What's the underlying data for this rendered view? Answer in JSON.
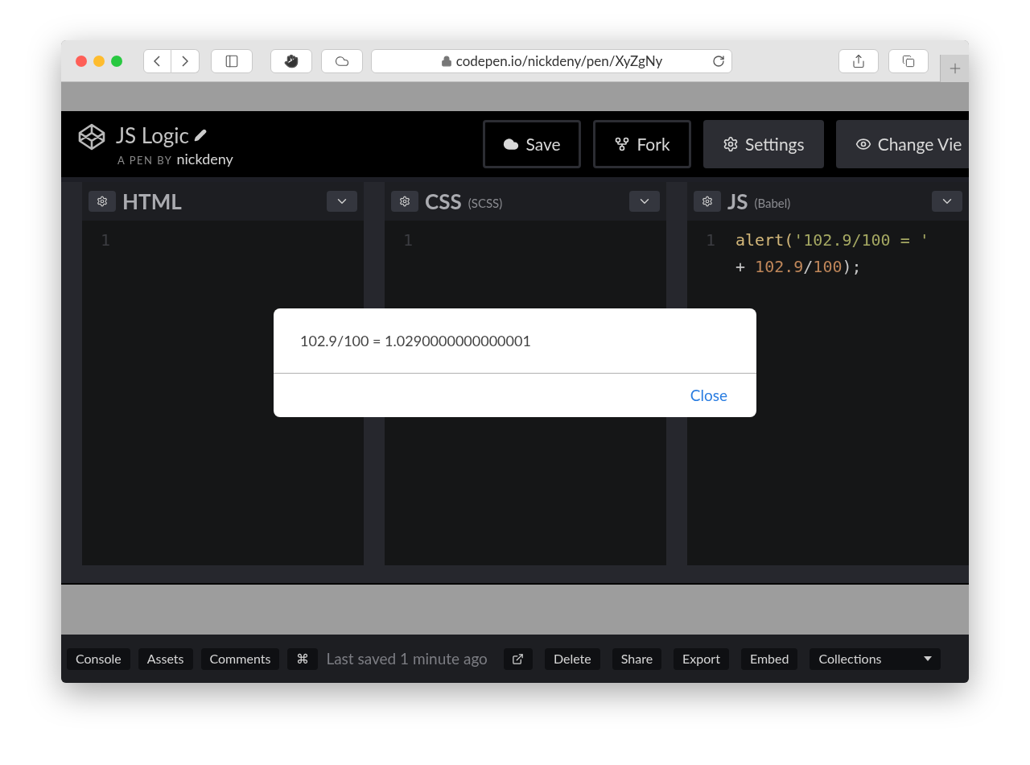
{
  "browser": {
    "url": "codepen.io/nickdeny/pen/XyZgNy"
  },
  "pen": {
    "title": "JS Logic",
    "byline_prefix": "A PEN BY",
    "author": "nickdeny"
  },
  "header_buttons": [
    {
      "label": "Save",
      "kind": "outline"
    },
    {
      "label": "Fork",
      "kind": "outline"
    },
    {
      "label": "Settings",
      "kind": "filled"
    },
    {
      "label": "Change Vie",
      "kind": "filled"
    }
  ],
  "editors": [
    {
      "name": "HTML",
      "lines": [
        {
          "number": "1"
        }
      ]
    },
    {
      "name": "CSS",
      "preprocessor": "(SCSS)",
      "lines": [
        {
          "number": "1"
        }
      ]
    },
    {
      "name": "JS",
      "preprocessor": "(Babel)",
      "lines": [
        {
          "number": "1",
          "tokens": [
            {
              "text": "alert(",
              "kind": "call"
            },
            {
              "text": "'102.9/100 = '",
              "kind": "string"
            }
          ]
        },
        {
          "tokens": [
            {
              "text": "+ ",
              "kind": "plain"
            },
            {
              "text": "102.9",
              "kind": "number"
            },
            {
              "text": "/",
              "kind": "plain"
            },
            {
              "text": "100",
              "kind": "number"
            },
            {
              "text": ");",
              "kind": "plain"
            }
          ]
        }
      ]
    }
  ],
  "alert": {
    "message": "102.9/100 = 1.0290000000000001",
    "button": "Close"
  },
  "footer": {
    "left_buttons": [
      "Console",
      "Assets",
      "Comments"
    ],
    "shortcut_key": "⌘",
    "status": "Last saved 1 minute ago",
    "right_buttons": [
      "Delete",
      "Share",
      "Export",
      "Embed"
    ],
    "collections": "Collections"
  }
}
